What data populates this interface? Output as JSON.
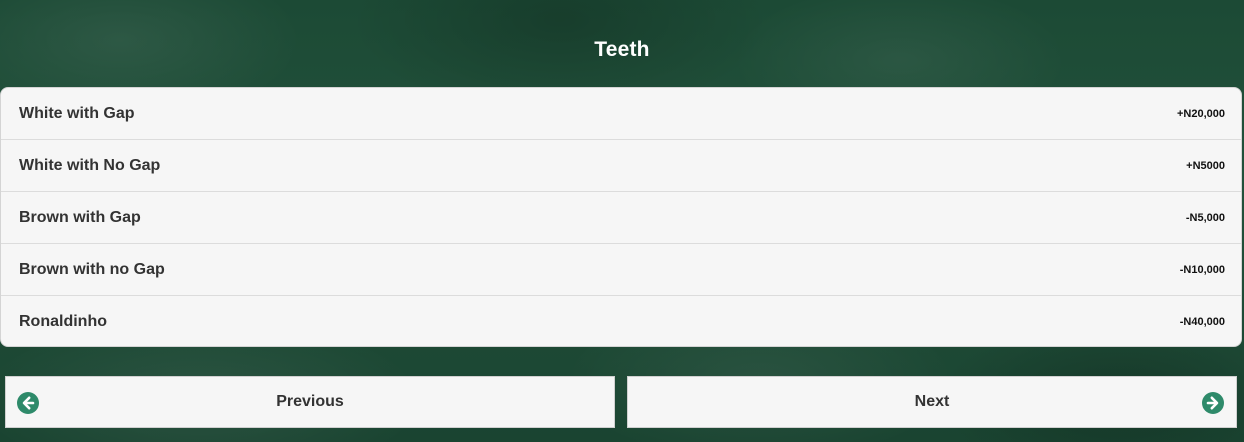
{
  "header": {
    "title": "Teeth"
  },
  "options": [
    {
      "label": "White with Gap",
      "price": "+N20,000"
    },
    {
      "label": "White with No Gap",
      "price": "+N5000"
    },
    {
      "label": "Brown with Gap",
      "price": "-N5,000"
    },
    {
      "label": "Brown with no Gap",
      "price": "-N10,000"
    },
    {
      "label": "Ronaldinho",
      "price": "-N40,000"
    }
  ],
  "nav": {
    "previous_label": "Previous",
    "next_label": "Next",
    "previous_icon": "arrow-left-circle-icon",
    "next_icon": "arrow-right-circle-icon",
    "icon_color": "#2e8a6a"
  },
  "colors": {
    "background": "#1d4a36",
    "panel": "#f6f6f6",
    "text": "#333333"
  }
}
